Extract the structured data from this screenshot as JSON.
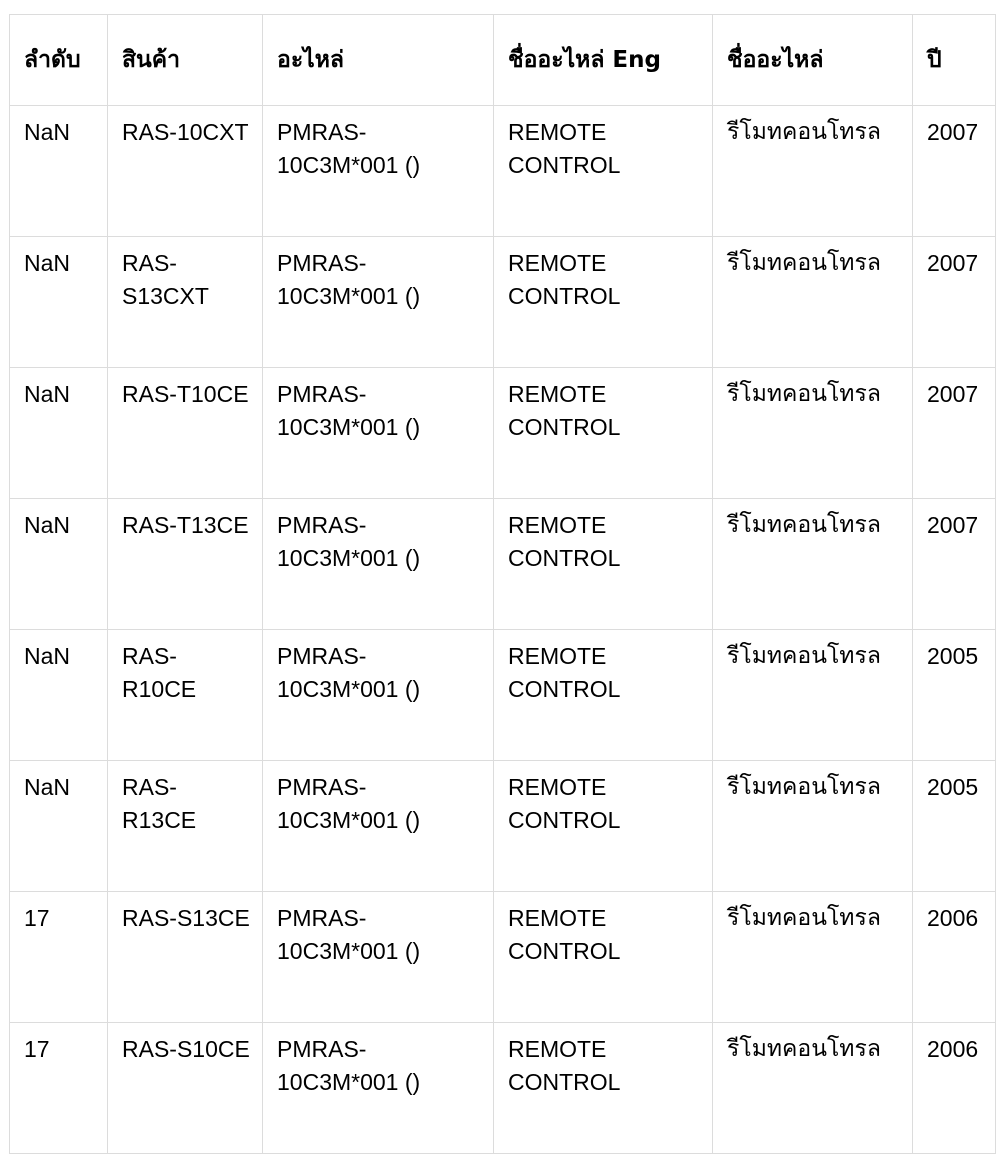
{
  "table": {
    "columns": [
      {
        "key": "seq",
        "label": "ลำดับ",
        "lang": "th"
      },
      {
        "key": "product",
        "label": "สินค้า",
        "lang": "th"
      },
      {
        "key": "part",
        "label": "อะไหล่",
        "lang": "th"
      },
      {
        "key": "name_en",
        "label": "ชื่ออะไหล่ Eng",
        "lang": "th"
      },
      {
        "key": "name_th",
        "label": "ชื่ออะไหล่",
        "lang": "th"
      },
      {
        "key": "year",
        "label": "ปี",
        "lang": "th"
      }
    ],
    "rows": [
      {
        "seq": "NaN",
        "product": "RAS-10CXT",
        "part": "PMRAS-10C3M*001 ()",
        "name_en": "REMOTE CONTROL",
        "name_th": "รีโมทคอนโทรล",
        "year": "2007"
      },
      {
        "seq": "NaN",
        "product": "RAS-S13CXT",
        "part": "PMRAS-10C3M*001 ()",
        "name_en": "REMOTE CONTROL",
        "name_th": "รีโมทคอนโทรล",
        "year": "2007"
      },
      {
        "seq": "NaN",
        "product": "RAS-T10CE",
        "part": "PMRAS-10C3M*001 ()",
        "name_en": "REMOTE CONTROL",
        "name_th": "รีโมทคอนโทรล",
        "year": "2007"
      },
      {
        "seq": "NaN",
        "product": "RAS-T13CE",
        "part": "PMRAS-10C3M*001 ()",
        "name_en": "REMOTE CONTROL",
        "name_th": "รีโมทคอนโทรล",
        "year": "2007"
      },
      {
        "seq": "NaN",
        "product": "RAS-R10CE",
        "part": "PMRAS-10C3M*001 ()",
        "name_en": "REMOTE CONTROL",
        "name_th": "รีโมทคอนโทรล",
        "year": "2005"
      },
      {
        "seq": "NaN",
        "product": "RAS-R13CE",
        "part": "PMRAS-10C3M*001 ()",
        "name_en": "REMOTE CONTROL",
        "name_th": "รีโมทคอนโทรล",
        "year": "2005"
      },
      {
        "seq": "17",
        "product": "RAS-S13CE",
        "part": "PMRAS-10C3M*001 ()",
        "name_en": "REMOTE CONTROL",
        "name_th": "รีโมทคอนโทรล",
        "year": "2006"
      },
      {
        "seq": "17",
        "product": "RAS-S10CE",
        "part": "PMRAS-10C3M*001 ()",
        "name_en": "REMOTE CONTROL",
        "name_th": "รีโมทคอนโทรล",
        "year": "2006"
      }
    ]
  },
  "style": {
    "border_color": "#dcdcdc",
    "text_color": "#000000",
    "background": "#ffffff"
  }
}
